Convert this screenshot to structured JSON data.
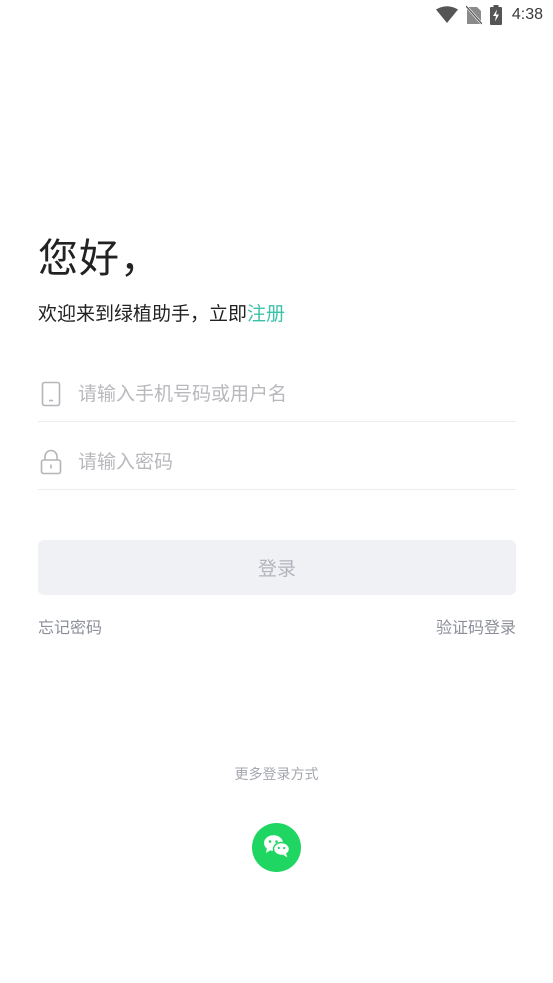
{
  "status_bar": {
    "time": "4:38",
    "icons": [
      "wifi-icon",
      "no-sim-icon",
      "battery-charging-icon"
    ]
  },
  "greeting": "您好，",
  "welcome": {
    "text": "欢迎来到绿植助手，立即",
    "register_link": "注册"
  },
  "form": {
    "phone_placeholder": "请输入手机号码或用户名",
    "password_placeholder": "请输入密码"
  },
  "login_button": "登录",
  "forgot_password": "忘记密码",
  "sms_login": "验证码登录",
  "more_login_methods": "更多登录方式",
  "colors": {
    "accent": "#3cc2a8",
    "wechat": "#1ed661",
    "button_bg": "#f0f1f5"
  }
}
